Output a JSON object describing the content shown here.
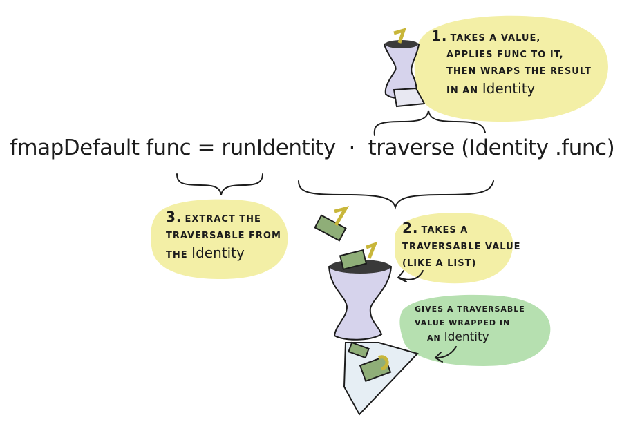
{
  "formula": {
    "name": "fmapDefault",
    "arg": "func",
    "equals": "=",
    "run_identity": "runIdentity",
    "dot": "·",
    "traverse": "traverse",
    "inner": "(Identity .func)"
  },
  "notes": {
    "note1": {
      "number": "1.",
      "line1": "TAKES A VALUE,",
      "line2": "APPLIES func TO IT,",
      "line3": "THEN WRAPS THE RESULT",
      "line4_prefix": "IN AN",
      "line4_word": "Identity"
    },
    "note2": {
      "number": "2.",
      "line1": "TAKES A",
      "line2": "TRAVERSABLE VALUE",
      "line3": "(LIKE A LIST)"
    },
    "note3": {
      "number": "3.",
      "line1": "EXTRACT THE",
      "line2": "TRAVERSABLE FROM",
      "line3_prefix": "THE",
      "line3_word": "Identity"
    },
    "note4": {
      "line1": "GIVES A TRAVERSABLE",
      "line2": "VALUE WRAPPED IN",
      "line3_prefix": "AN",
      "line3_word": "Identity"
    }
  },
  "colors": {
    "yellow_bubble": "#f3efa6",
    "green_bubble": "#b6e0b0",
    "funnel": "#d6d3ec",
    "value_box": "#8fae78",
    "value_number": "#e3d45a"
  },
  "icons": [
    "identity-funnel-icon",
    "traversable-list-icon",
    "value-number-icon"
  ]
}
